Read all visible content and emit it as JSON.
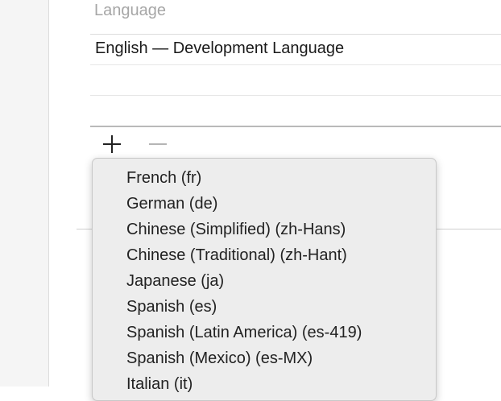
{
  "localizations": {
    "column_header": "Language",
    "rows": [
      "English — Development Language",
      "",
      ""
    ]
  },
  "controls": {
    "add_icon": "plus-icon",
    "remove_icon": "minus-icon"
  },
  "language_menu": {
    "items": [
      "French (fr)",
      "German (de)",
      "Chinese (Simplified) (zh-Hans)",
      "Chinese (Traditional) (zh-Hant)",
      "Japanese (ja)",
      "Spanish (es)",
      "Spanish (Latin America) (es-419)",
      "Spanish (Mexico) (es-MX)",
      "Italian (it)"
    ]
  },
  "colors": {
    "menu_background": "#ededed",
    "header_text": "#a6a6a6",
    "disabled_control": "#b5b5b5"
  }
}
